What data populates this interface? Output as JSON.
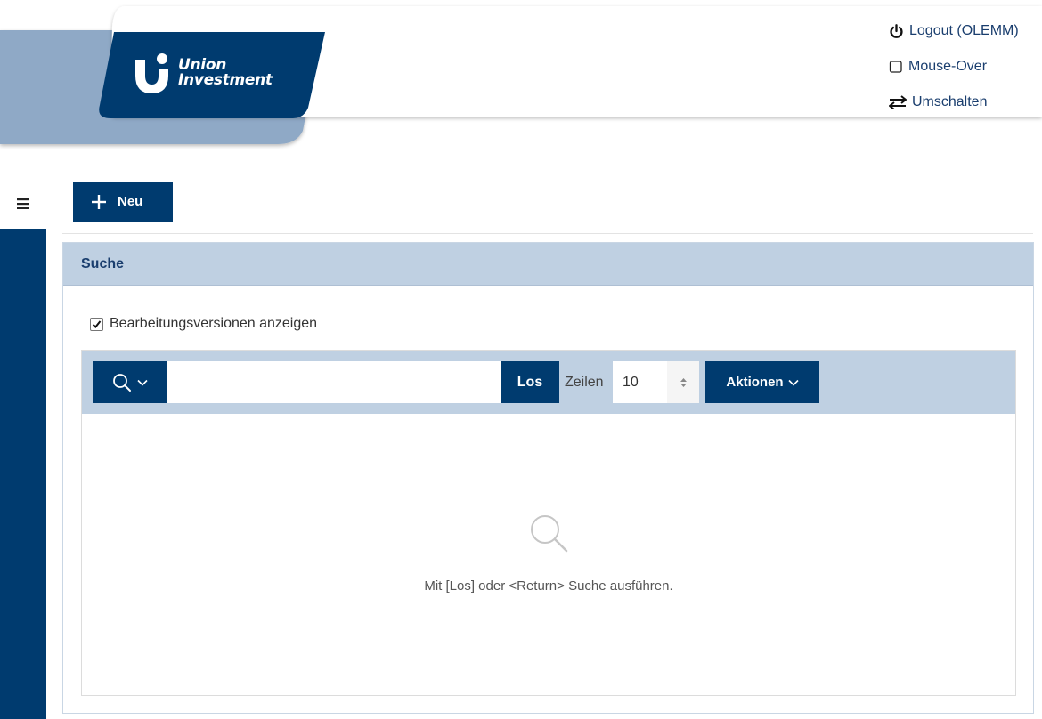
{
  "header": {
    "logo": {
      "line1": "Union",
      "line2": "Investment"
    },
    "links": [
      {
        "label": "Logout (OLEMM)",
        "icon": "power-icon"
      },
      {
        "label": "Mouse-Over",
        "icon": "checkbox-icon"
      },
      {
        "label": "Umschalten",
        "icon": "switch-arrows-icon"
      }
    ]
  },
  "sidebar": {
    "toggle_icon": "hamburger-menu-icon"
  },
  "toolbar": {
    "new_label": "Neu",
    "new_icon": "plus-icon"
  },
  "panel": {
    "title": "Suche",
    "show_versions_label": "Bearbeitungsversionen anzeigen",
    "show_versions_checked": true,
    "search": {
      "type_icon": "search-icon",
      "input_value": "",
      "go_label": "Los",
      "rows_label": "Zeilen",
      "rows_value": "10",
      "actions_label": "Aktionen"
    },
    "empty_message": "Mit [Los] oder <Return> Suche ausführen."
  },
  "colors": {
    "primary": "#003b6f",
    "header_light": "#8fa9c6",
    "panel_header": "#bfd0e2",
    "link": "#1a3e6e"
  }
}
